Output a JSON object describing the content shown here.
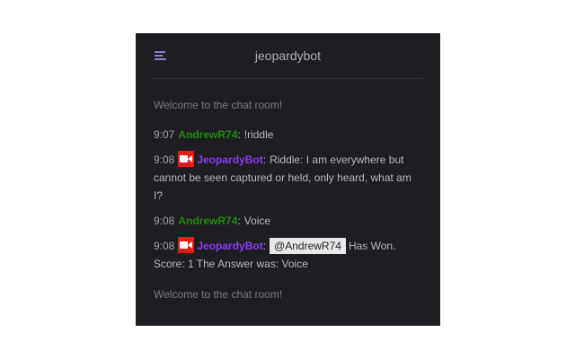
{
  "header": {
    "title": "jeopardybot",
    "menu_icon": "hamburger-menu-icon"
  },
  "colors": {
    "panel_bg": "#1e1d21",
    "green_user": "#1e8a0e",
    "purple_user": "#8a3df2",
    "badge_red": "#e91916"
  },
  "system": {
    "welcome_top": "Welcome to the chat room!",
    "welcome_bottom": "Welcome to the chat room!"
  },
  "messages": [
    {
      "time": "9:07",
      "user": "AndrewR74",
      "text": "!riddle"
    },
    {
      "time": "9:08",
      "user": "JeopardyBot",
      "badge_icon": "video-camera-icon",
      "text": "Riddle: I am everywhere but cannot be seen captured or held, only heard, what am I?"
    },
    {
      "time": "9:08",
      "user": "AndrewR74",
      "text": "Voice"
    },
    {
      "time": "9:08",
      "user": "JeopardyBot",
      "badge_icon": "video-camera-icon",
      "mention": "@AndrewR74",
      "text": "Has Won. Score: 1 The Answer was: Voice"
    }
  ]
}
